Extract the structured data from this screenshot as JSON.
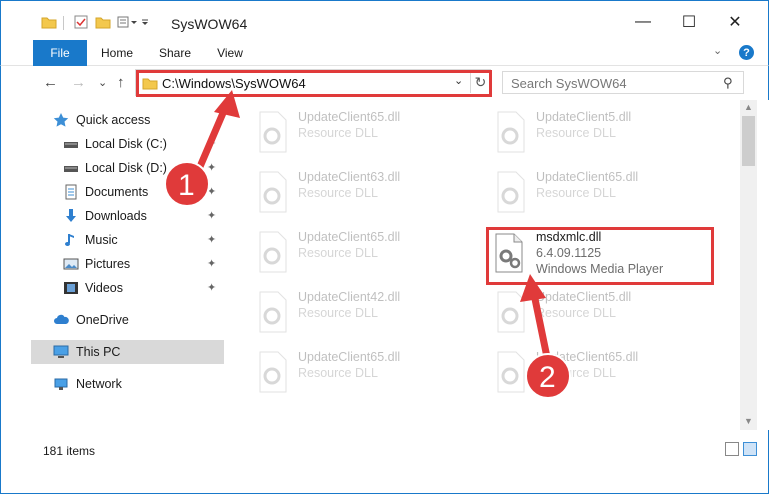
{
  "window": {
    "title": "SysWOW64",
    "minimize": "—",
    "maximize": "☐",
    "close": "✕"
  },
  "ribbon": {
    "tabs": [
      "File",
      "Home",
      "Share",
      "View"
    ],
    "collapse": "⌄",
    "help": "?"
  },
  "nav": {
    "back": "←",
    "forward": "→",
    "recent": "⌄",
    "up": "↑",
    "address": "C:\\Windows\\SysWOW64",
    "address_dropdown": "⌄",
    "refresh": "↻",
    "search_placeholder": "Search SysWOW64",
    "search_icon": "⚲"
  },
  "sidebar": {
    "items": [
      {
        "label": "Quick access",
        "icon": "star-icon"
      },
      {
        "label": "Local Disk (C:)",
        "icon": "drive-icon"
      },
      {
        "label": "Local Disk (D:)",
        "icon": "drive-icon"
      },
      {
        "label": "Documents",
        "icon": "documents-icon"
      },
      {
        "label": "Downloads",
        "icon": "downloads-icon"
      },
      {
        "label": "Music",
        "icon": "music-icon"
      },
      {
        "label": "Pictures",
        "icon": "pictures-icon"
      },
      {
        "label": "Videos",
        "icon": "videos-icon"
      },
      {
        "label": "OneDrive",
        "icon": "cloud-icon"
      },
      {
        "label": "This PC",
        "icon": "pc-icon"
      },
      {
        "label": "Network",
        "icon": "network-icon"
      }
    ],
    "pin": "📌"
  },
  "files": {
    "left": [
      {
        "name": "UpdateClient65.dll",
        "type": "Resource DLL"
      },
      {
        "name": "UpdateClient63.dll",
        "type": "Resource DLL"
      },
      {
        "name": "UpdateClient65.dll",
        "type": "Resource DLL"
      },
      {
        "name": "UpdateClient42.dll",
        "type": "Resource DLL"
      },
      {
        "name": "UpdateClient65.dll",
        "type": "Resource DLL"
      }
    ],
    "right": [
      {
        "name": "UpdateClient5.dll",
        "type": "Resource DLL"
      },
      {
        "name": "UpdateClient65.dll",
        "type": "Resource DLL"
      },
      {
        "name": "UpdateClient5.dll",
        "type": "Resource DLL"
      },
      {
        "name": "UpdateClient65.dll",
        "type": "Resource DLL"
      }
    ],
    "highlight": {
      "name": "msdxmlc.dll",
      "version": "6.4.09.1125",
      "description": "Windows Media Player"
    }
  },
  "status": {
    "item_count": "181 items"
  },
  "annotations": {
    "step1": "1",
    "step2": "2",
    "color": "#e03a3a"
  }
}
